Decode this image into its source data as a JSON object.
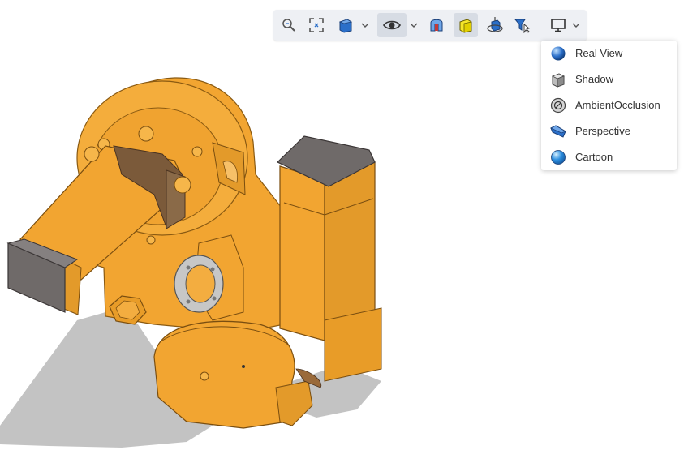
{
  "toolbar": {
    "buttons": [
      {
        "name": "zoom-icon"
      },
      {
        "name": "fit-all-icon"
      },
      {
        "name": "view-cube-icon"
      },
      {
        "name": "visibility-eye-icon"
      },
      {
        "name": "section-view-icon"
      },
      {
        "name": "shaded-display-icon"
      },
      {
        "name": "rotate-center-icon"
      },
      {
        "name": "selection-filter-icon"
      },
      {
        "name": "display-mode-monitor-icon"
      }
    ]
  },
  "render_menu": {
    "items": [
      {
        "label": "Real View",
        "icon": "real-view-sphere-icon"
      },
      {
        "label": "Shadow",
        "icon": "shadow-cube-icon"
      },
      {
        "label": "AmbientOcclusion",
        "icon": "ambient-occlusion-icon"
      },
      {
        "label": "Perspective",
        "icon": "perspective-prism-icon"
      },
      {
        "label": "Cartoon",
        "icon": "cartoon-sphere-icon"
      }
    ]
  },
  "colors": {
    "model_orange": "#f2a531",
    "model_shade": "#d98a1f",
    "plate_gray": "#6f6a69",
    "shadow_gray": "#b5b5b5",
    "toolbar_bg": "#eef0f4",
    "accent_blue": "#2b6fc9"
  }
}
